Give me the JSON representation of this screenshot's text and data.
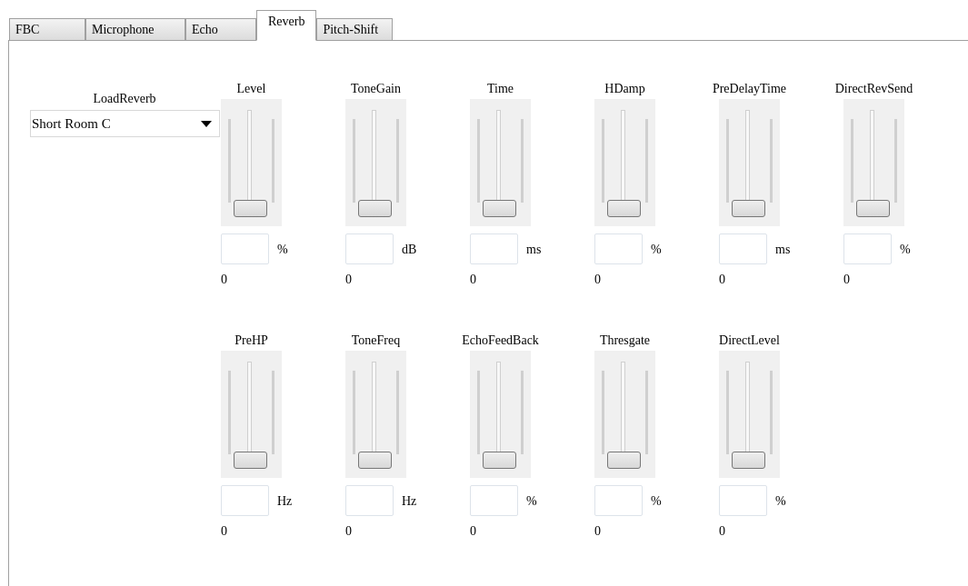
{
  "tabs": [
    {
      "label": "FBC",
      "selected": false
    },
    {
      "label": "Microphone",
      "selected": false
    },
    {
      "label": "Echo",
      "selected": false
    },
    {
      "label": "Reverb",
      "selected": true
    },
    {
      "label": "Pitch-Shift",
      "selected": false
    }
  ],
  "load_reverb": {
    "label": "LoadReverb",
    "value": "Short Room C"
  },
  "slider_rows": [
    [
      {
        "label": "Level",
        "level": 0,
        "unit": "%",
        "reading": "0"
      },
      {
        "label": "ToneGain",
        "level": 0,
        "unit": "dB",
        "reading": "0"
      },
      {
        "label": "Time",
        "level": 0,
        "unit": "ms",
        "reading": "0"
      },
      {
        "label": "HDamp",
        "level": 0,
        "unit": "%",
        "reading": "0"
      },
      {
        "label": "PreDelayTime",
        "level": 0,
        "unit": "ms",
        "reading": "0"
      },
      {
        "label": "DirectRevSend",
        "level": 0,
        "unit": "%",
        "reading": "0"
      }
    ],
    [
      {
        "label": "PreHP",
        "level": 0,
        "unit": "Hz",
        "reading": "0"
      },
      {
        "label": "ToneFreq",
        "level": 0,
        "unit": "Hz",
        "reading": "0"
      },
      {
        "label": "EchoFeedBack",
        "level": 0,
        "unit": "%",
        "reading": "0"
      },
      {
        "label": "Thresgate",
        "level": 0,
        "unit": "%",
        "reading": "0"
      },
      {
        "label": "DirectLevel",
        "level": 0,
        "unit": "%",
        "reading": "0"
      }
    ]
  ]
}
